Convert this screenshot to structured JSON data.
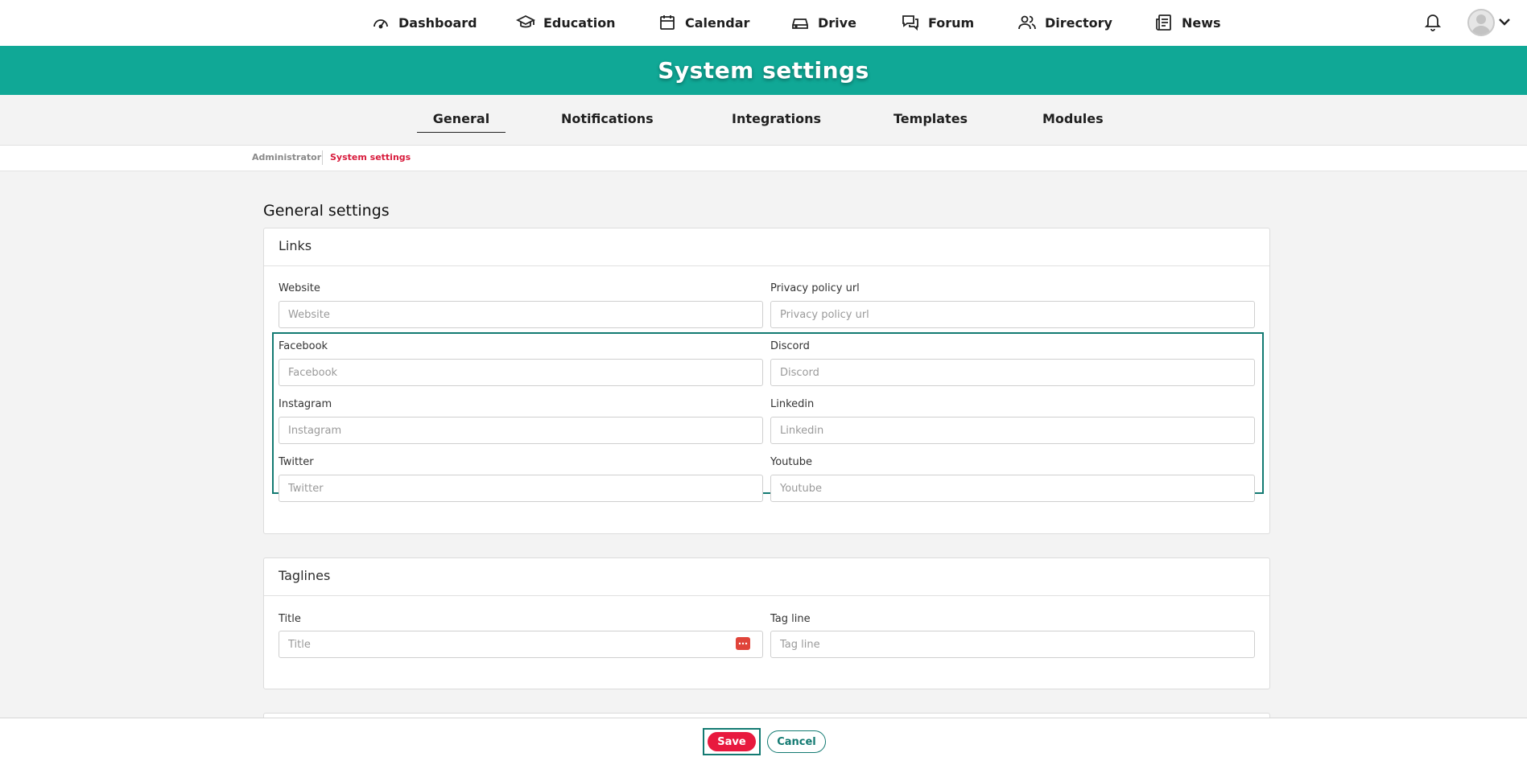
{
  "nav": {
    "items": [
      {
        "label": "Dashboard",
        "icon": "gauge-icon"
      },
      {
        "label": "Education",
        "icon": "graduation-cap-icon"
      },
      {
        "label": "Calendar",
        "icon": "calendar-icon"
      },
      {
        "label": "Drive",
        "icon": "drive-icon"
      },
      {
        "label": "Forum",
        "icon": "chat-bubbles-icon"
      },
      {
        "label": "Directory",
        "icon": "people-icon"
      },
      {
        "label": "News",
        "icon": "newspaper-icon"
      }
    ]
  },
  "banner": {
    "title": "System settings"
  },
  "tabs": [
    {
      "label": "General",
      "active": true
    },
    {
      "label": "Notifications"
    },
    {
      "label": "Integrations"
    },
    {
      "label": "Templates"
    },
    {
      "label": "Modules"
    }
  ],
  "breadcrumb": {
    "items": [
      "Administrator",
      "System settings"
    ]
  },
  "page": {
    "section_title": "General settings"
  },
  "links": {
    "title": "Links",
    "fields": {
      "website": {
        "label": "Website",
        "placeholder": "Website"
      },
      "privacy": {
        "label": "Privacy policy url",
        "placeholder": "Privacy policy url"
      },
      "facebook": {
        "label": "Facebook",
        "placeholder": "Facebook"
      },
      "discord": {
        "label": "Discord",
        "placeholder": "Discord"
      },
      "instagram": {
        "label": "Instagram",
        "placeholder": "Instagram"
      },
      "linkedin": {
        "label": "Linkedin",
        "placeholder": "Linkedin"
      },
      "twitter": {
        "label": "Twitter",
        "placeholder": "Twitter"
      },
      "youtube": {
        "label": "Youtube",
        "placeholder": "Youtube"
      }
    }
  },
  "taglines": {
    "title": "Taglines",
    "fields": {
      "title": {
        "label": "Title",
        "placeholder": "Title"
      },
      "tagline": {
        "label": "Tag line",
        "placeholder": "Tag line"
      }
    }
  },
  "footer": {
    "save_label": "Save",
    "cancel_label": "Cancel"
  },
  "colors": {
    "brand": "#10a896",
    "accent": "#e8193e",
    "highlight": "#137a72",
    "breadcrumb_active": "#d81b3c"
  }
}
